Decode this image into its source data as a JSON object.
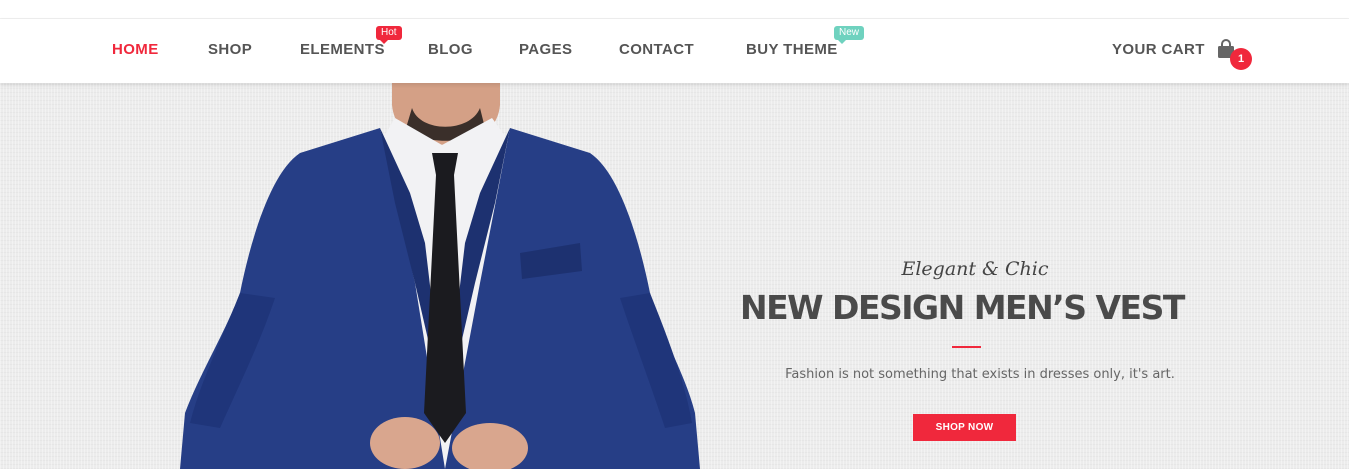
{
  "nav": {
    "items": [
      {
        "label": "HOME",
        "active": true
      },
      {
        "label": "SHOP"
      },
      {
        "label": "ELEMENTS",
        "badge": "Hot"
      },
      {
        "label": "BLOG"
      },
      {
        "label": "PAGES"
      },
      {
        "label": "CONTACT"
      },
      {
        "label": "BUY THEME",
        "badge": "New"
      }
    ],
    "cart": {
      "label": "YOUR CART",
      "count": "1",
      "icon": "shopping-bag-icon"
    }
  },
  "hero": {
    "subtitle": "Elegant & Chic",
    "headline": "NEW DESIGN MEN’S VEST",
    "tagline": "Fashion is not something that exists in dresses only, it's art.",
    "cta_label": "SHOP NOW"
  },
  "colors": {
    "accent": "#f0283c",
    "badge_new": "#6fd2bf",
    "nav_text": "#555555",
    "hero_background": "#ececec",
    "suit_navy": "#263e86"
  }
}
